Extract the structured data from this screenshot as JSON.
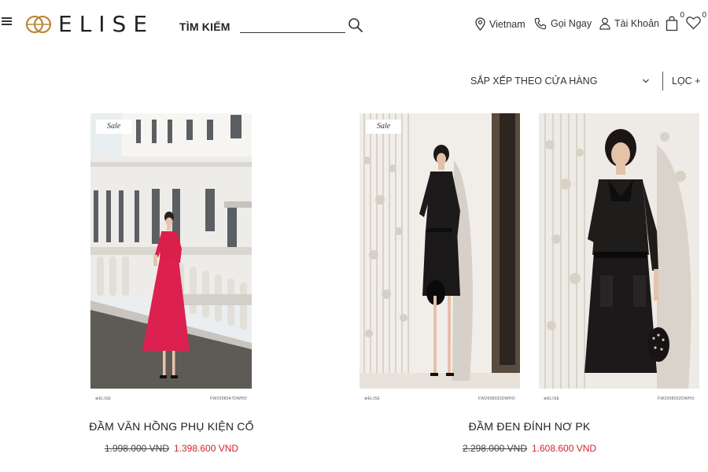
{
  "brand": {
    "name": "ELISE"
  },
  "search": {
    "label": "TÌM KIẾM",
    "value": "",
    "placeholder": ""
  },
  "utility": {
    "country": "Vietnam",
    "call": "Gọi Ngay",
    "account": "Tài Khoản",
    "cart_count": "0",
    "wishlist_count": "0"
  },
  "toolbar": {
    "sort_label": "SẮP XẾP THEO CỬA HÀNG",
    "filter_label": "LỌC +"
  },
  "products": [
    {
      "name": "ĐẦM VĂN HỒNG PHỤ KIỆN CỔ",
      "old_price": "1.998.000 VND",
      "new_price": "1.398.600 VND",
      "badge": "Sale",
      "strip_brand": "⊕ELISE",
      "strip_code": "FW2008047DWHO"
    },
    {
      "name": "ĐẦM ĐEN ĐÍNH NƠ PK",
      "old_price": "2.298.000 VND",
      "new_price": "1.608.600 VND",
      "badge": "Sale",
      "strip_brand_left": "⊕ELISE",
      "strip_code_left": "FW2008032DWHO",
      "strip_brand_right": "⊕ELISE",
      "strip_code_right": "FW2008032DWHO"
    }
  ],
  "colors": {
    "sale_price": "#d0262e",
    "logo_gold": "#b8893b",
    "text": "#222222"
  }
}
